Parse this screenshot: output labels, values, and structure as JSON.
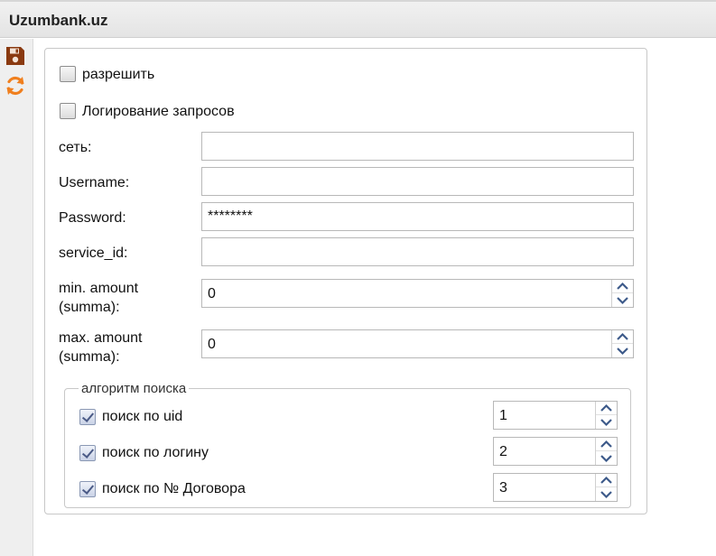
{
  "window": {
    "title": "Uzumbank.uz"
  },
  "toolbar": {
    "save_icon": "floppy-disk-icon",
    "refresh_icon": "refresh-icon"
  },
  "form": {
    "enable_label": "разрешить",
    "logging_label": "Логирование запросов",
    "network_label": "сеть:",
    "network_value": "",
    "username_label": "Username:",
    "username_value": "",
    "password_label": "Password:",
    "password_value": "********",
    "service_id_label": "service_id:",
    "service_id_value": "",
    "min_amount_label_line1": "min. amount",
    "min_amount_label_line2": "(summa):",
    "min_amount_value": "0",
    "max_amount_label_line1": "max. amount",
    "max_amount_label_line2": "(summa):",
    "max_amount_value": "0",
    "enable_checked": false,
    "logging_checked": false
  },
  "search_algorithm": {
    "legend": "алгоритм поиска",
    "items": [
      {
        "label": "поиск по uid",
        "checked": true,
        "order": "1"
      },
      {
        "label": "поиск по логину",
        "checked": true,
        "order": "2"
      },
      {
        "label": "поиск по № Договора",
        "checked": true,
        "order": "3"
      }
    ]
  }
}
